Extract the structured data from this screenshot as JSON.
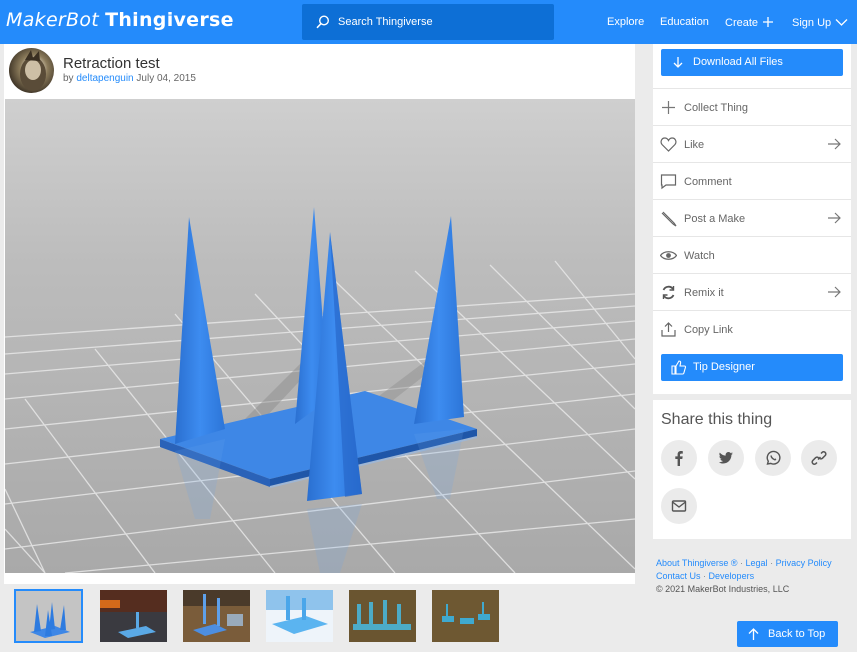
{
  "header": {
    "logo_part1": "MakerBot",
    "logo_part2": "Thingiverse",
    "search_placeholder": "Search Thingiverse",
    "nav": {
      "explore": "Explore",
      "education": "Education",
      "create": "Create",
      "signup": "Sign Up"
    }
  },
  "thing": {
    "title": "Retraction test",
    "by_prefix": "by",
    "author": "deltapenguin",
    "date": "July 04, 2015"
  },
  "actions": {
    "download": "Download All Files",
    "items": [
      {
        "label": "Collect Thing",
        "icon": "plus-icon",
        "arrow": false
      },
      {
        "label": "Like",
        "icon": "heart-icon",
        "arrow": true
      },
      {
        "label": "Comment",
        "icon": "comment-icon",
        "arrow": false
      },
      {
        "label": "Post a Make",
        "icon": "brush-icon",
        "arrow": true
      },
      {
        "label": "Watch",
        "icon": "eye-icon",
        "arrow": false
      },
      {
        "label": "Remix it",
        "icon": "remix-icon",
        "arrow": true
      },
      {
        "label": "Copy Link",
        "icon": "share-icon",
        "arrow": false
      }
    ],
    "tip": "Tip Designer"
  },
  "share": {
    "title": "Share this thing",
    "icons": [
      "facebook-icon",
      "twitter-icon",
      "whatsapp-icon",
      "link-icon",
      "email-icon"
    ]
  },
  "footer": {
    "about": "About Thingiverse ®",
    "legal": "Legal",
    "privacy": "Privacy Policy",
    "contact": "Contact Us",
    "developers": "Developers",
    "copyright": "©  2021 MakerBot Industries, LLC",
    "back_to_top": "Back to Top"
  },
  "colors": {
    "accent": "#248bfb",
    "model_blue": "#2e7fe0"
  }
}
